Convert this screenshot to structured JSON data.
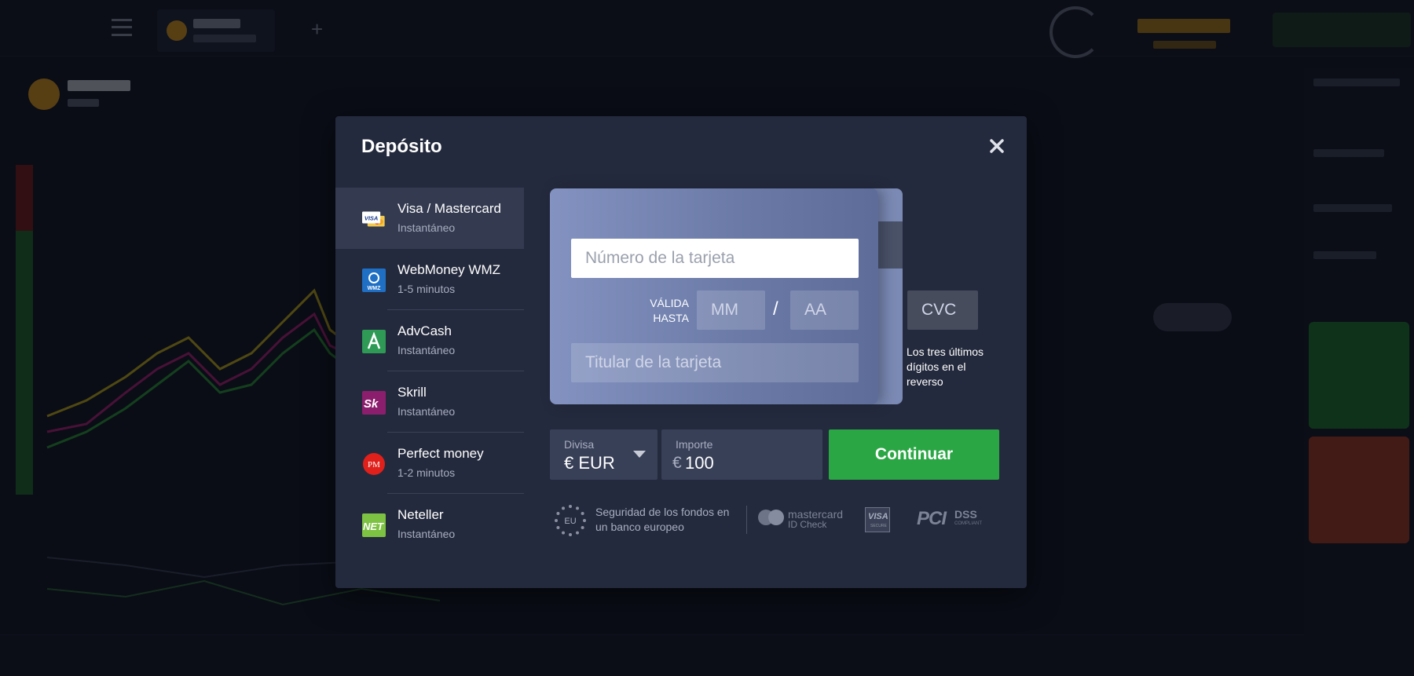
{
  "modal": {
    "title": "Depósito",
    "methods": [
      {
        "name": "Visa / Mastercard",
        "time": "Instantáneo",
        "icon": "visa-mastercard-icon",
        "selected": true
      },
      {
        "name": "WebMoney WMZ",
        "time": "1-5 minutos",
        "icon": "webmoney-icon"
      },
      {
        "name": "AdvCash",
        "time": "Instantáneo",
        "icon": "advcash-icon"
      },
      {
        "name": "Skrill",
        "time": "Instantáneo",
        "icon": "skrill-icon"
      },
      {
        "name": "Perfect money",
        "time": "1-2 minutos",
        "icon": "perfect-money-icon"
      },
      {
        "name": "Neteller",
        "time": "Instantáneo",
        "icon": "neteller-icon"
      }
    ],
    "card": {
      "number_placeholder": "Número de la tarjeta",
      "valid_label": "VÁLIDA HASTA",
      "month_placeholder": "MM",
      "separator": "/",
      "year_placeholder": "AA",
      "holder_placeholder": "Titular de la tarjeta",
      "cvc_placeholder": "CVC",
      "cvc_hint": "Los tres últimos dígitos en el reverso"
    },
    "currency": {
      "label": "Divisa",
      "value": "€ EUR"
    },
    "amount": {
      "label": "Importe",
      "symbol": "€",
      "value": "100"
    },
    "continue_label": "Continuar",
    "security": {
      "eu_badge": "EU",
      "text": "Seguridad de los fondos en un banco europeo",
      "mastercard_line1": "mastercard",
      "mastercard_line2": "ID Check",
      "visa_line1": "VISA",
      "visa_line2": "SECURE",
      "pci_mark": "PCI",
      "pci_dss": "DSS",
      "pci_compliant": "COMPLIANT"
    }
  },
  "colors": {
    "modal_bg": "#242a3d",
    "selected_method_bg": "#343b51",
    "card_front": "#7b8ab4",
    "continue_button": "#2aa744",
    "field_bg": "#384058"
  }
}
